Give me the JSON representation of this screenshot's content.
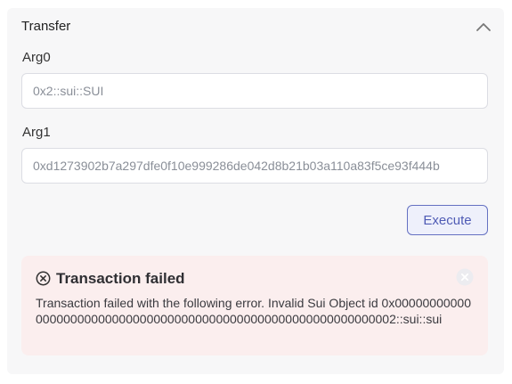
{
  "panel": {
    "title": "Transfer"
  },
  "args": [
    {
      "label": "Arg0",
      "value": "0x2::sui::SUI"
    },
    {
      "label": "Arg1",
      "value": "0xd1273902b7a297dfe0f10e999286de042d8b21b03a110a83f5ce93f444b"
    }
  ],
  "actions": {
    "execute_label": "Execute"
  },
  "alert": {
    "title": "Transaction failed",
    "message": "Transaction failed with the following error. Invalid Sui Object id 0x000000000000000000000000000000000000000000000000000000000000002::sui::sui"
  },
  "colors": {
    "accent": "#4f5bb5",
    "error_bg": "#fbeeee",
    "panel_bg": "#f7f7f8"
  },
  "icons": {
    "collapse": "chevron-up-icon",
    "error": "circle-x-icon",
    "close": "close-icon"
  }
}
